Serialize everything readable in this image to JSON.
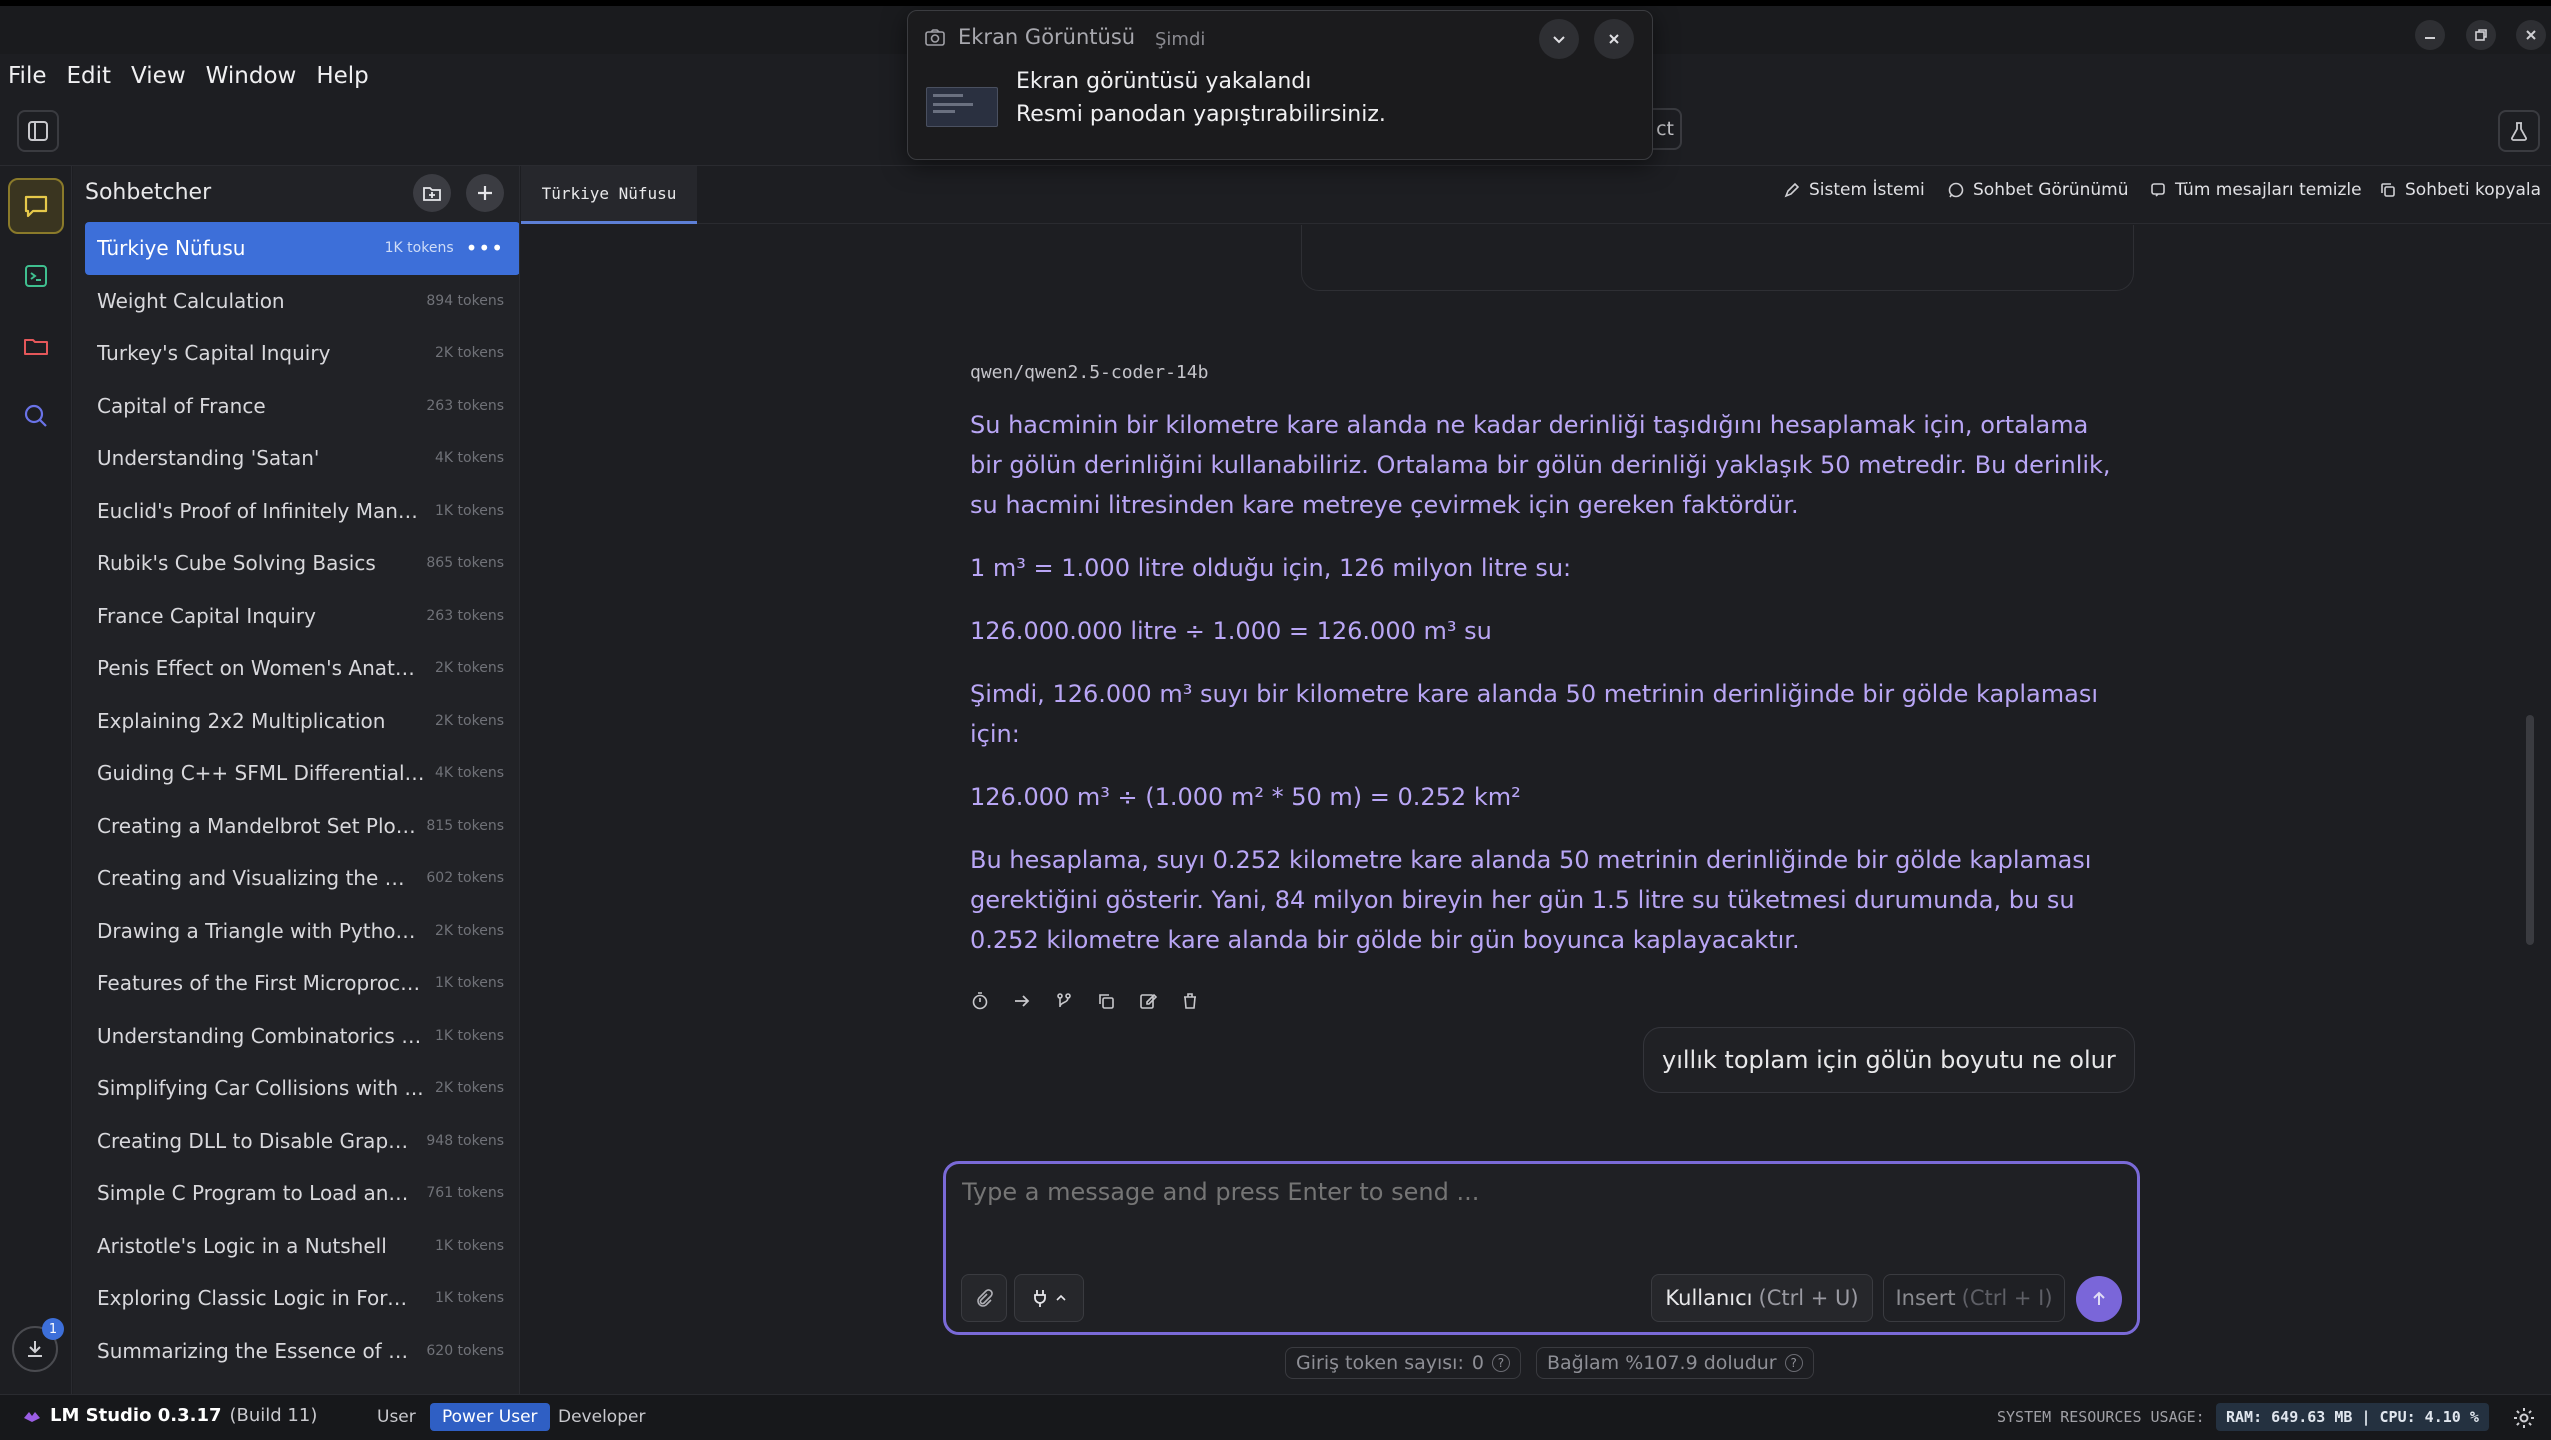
{
  "menu": [
    "File",
    "Edit",
    "View",
    "Window",
    "Help"
  ],
  "toolbar": {
    "hidden_button_fragment": "ct"
  },
  "notification": {
    "app": "Ekran Görüntüsü",
    "time": "Şimdi",
    "title": "Ekran görüntüsü yakalandı",
    "body": "Resmi panodan yapıştırabilirsiniz."
  },
  "sidebar": {
    "title": "Sohbetcher",
    "chats": [
      {
        "title": "Türkiye Nüfusu",
        "tokens": "1K tokens",
        "active": true
      },
      {
        "title": "Weight Calculation",
        "tokens": "894 tokens"
      },
      {
        "title": "Turkey's Capital Inquiry",
        "tokens": "2K tokens"
      },
      {
        "title": "Capital of France",
        "tokens": "263 tokens"
      },
      {
        "title": "Understanding 'Satan'",
        "tokens": "4K tokens"
      },
      {
        "title": "Euclid's Proof of Infinitely Many ...",
        "tokens": "1K tokens"
      },
      {
        "title": "Rubik's Cube Solving Basics",
        "tokens": "865 tokens"
      },
      {
        "title": "France Capital Inquiry",
        "tokens": "263 tokens"
      },
      {
        "title": "Penis Effect on Women's Anato...",
        "tokens": "2K tokens"
      },
      {
        "title": "Explaining 2x2 Multiplication",
        "tokens": "2K tokens"
      },
      {
        "title": "Guiding C++ SFML Differential ...",
        "tokens": "4K tokens"
      },
      {
        "title": "Creating a Mandelbrot Set Plot...",
        "tokens": "815 tokens"
      },
      {
        "title": "Creating and Visualizing the M...",
        "tokens": "602 tokens"
      },
      {
        "title": "Drawing a Triangle with Python ...",
        "tokens": "2K tokens"
      },
      {
        "title": "Features of the First Microproce...",
        "tokens": "1K tokens"
      },
      {
        "title": "Understanding Combinatorics i...",
        "tokens": "1K tokens"
      },
      {
        "title": "Simplifying Car Collisions with ...",
        "tokens": "2K tokens"
      },
      {
        "title": "Creating DLL to Disable Graphi...",
        "tokens": "948 tokens"
      },
      {
        "title": "Simple C Program to Load and ...",
        "tokens": "761 tokens"
      },
      {
        "title": "Aristotle's Logic in a Nutshell",
        "tokens": "1K tokens"
      },
      {
        "title": "Exploring Classic Logic in Form...",
        "tokens": "1K tokens"
      },
      {
        "title": "Summarizing the Essence of A...",
        "tokens": "620 tokens"
      }
    ]
  },
  "tab": {
    "label": "Türkiye Nüfusu"
  },
  "actions": {
    "system_prompt": "Sistem İstemi",
    "chat_view": "Sohbet Görünümü",
    "clear_all": "Tüm mesajları temizle",
    "copy_chat": "Sohbeti kopyala"
  },
  "message": {
    "model": "qwen/qwen2.5-coder-14b",
    "paragraphs": [
      "Su hacminin bir kilometre kare alanda ne kadar derinliği taşıdığını hesaplamak için, ortalama bir gölün derinliğini kullanabiliriz. Ortalama bir gölün derinliği yaklaşık 50 metredir. Bu derinlik, su hacmini litresinden kare metreye çevirmek için gereken faktördür.",
      "1 m³ = 1.000 litre olduğu için, 126 milyon litre su:",
      "126.000.000 litre ÷ 1.000 = 126.000 m³ su",
      "Şimdi, 126.000 m³ suyı bir kilometre kare alanda 50 metrinin derinliğinde bir gölde kaplaması için:",
      "126.000 m³ ÷ (1.000 m² * 50 m) = 0.252 km²",
      "Bu hesaplama, suyı 0.252 kilometre kare alanda 50 metrinin derinliğinde bir gölde kaplaması gerektiğini gösterir. Yani, 84 milyon bireyin her gün 1.5 litre su tüketmesi durumunda, bu su 0.252 kilometre kare alanda bir gölde bir gün boyunca kaplayacaktır."
    ]
  },
  "user_message": "yıllık toplam için gölün boyutu ne olur",
  "input": {
    "placeholder": "Type a message and press Enter to send ...",
    "role_label": "Kullanıcı",
    "role_shortcut": "(Ctrl + U)",
    "insert_label": "Insert",
    "insert_shortcut": "(Ctrl + I)"
  },
  "token_info": {
    "input_label": "Giriş token sayısı:",
    "input_count": "0",
    "context": "Bağlam %107.9 doludur"
  },
  "status": {
    "app_name": "LM Studio 0.3.17",
    "build": "(Build 11)",
    "modes": [
      "User",
      "Power User",
      "Developer"
    ],
    "active_mode": "Power User",
    "resources_label": "SYSTEM RESOURCES USAGE:",
    "resources_value": "RAM: 649.63 MB | CPU: 4.10 %",
    "download_badge": "1"
  },
  "colors": {
    "accent": "#3d6fd9",
    "assistant_text": "#b9a6f5",
    "input_border": "#7a6ad8",
    "rail_active": "#e6c94a"
  }
}
